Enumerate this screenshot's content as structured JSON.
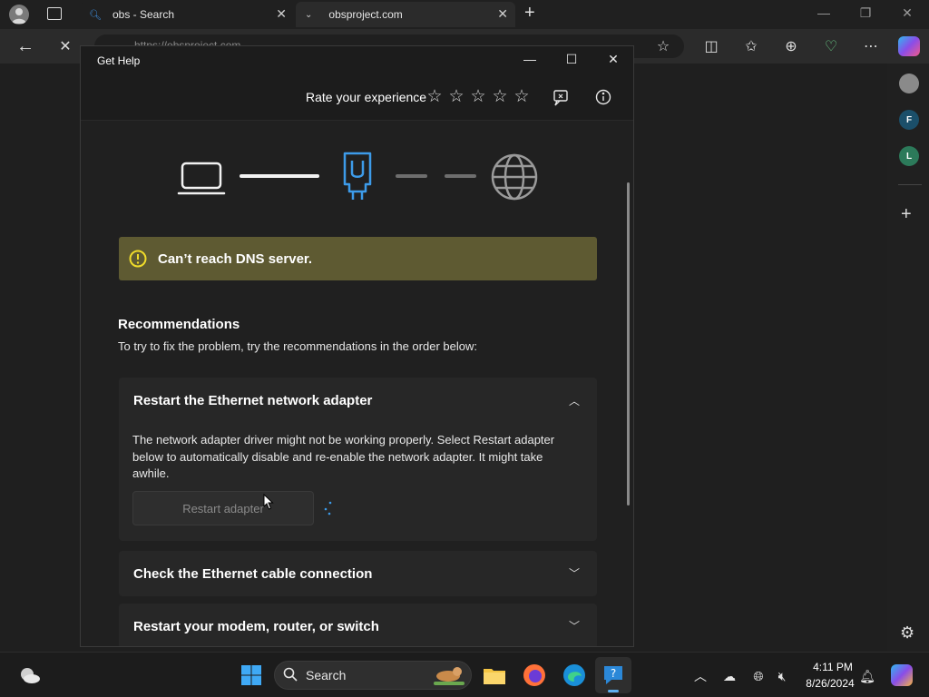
{
  "browser": {
    "tabs": [
      {
        "title": "obs - Search"
      },
      {
        "title": "obsproject.com"
      }
    ],
    "address": "https://obsproject.com",
    "sidebar_badges": [
      "F",
      "L"
    ]
  },
  "gethelp": {
    "window_title": "Get Help",
    "rate_label": "Rate your experience",
    "rating_max": 5,
    "banner": "Can’t reach DNS server.",
    "recommendations_title": "Recommendations",
    "recommendations_subtitle": "To try to fix the problem, try the recommendations in the order below:",
    "cards": [
      {
        "title": "Restart the Ethernet network adapter",
        "expanded": true,
        "description": "The network adapter driver might not be working properly. Select Restart adapter below to automatically disable and re-enable the network adapter. It might take awhile.",
        "button": "Restart adapter"
      },
      {
        "title": "Check the Ethernet cable connection",
        "expanded": false
      },
      {
        "title": "Restart your modem, router, or switch",
        "expanded": false
      }
    ]
  },
  "taskbar": {
    "search_label": "Search",
    "time": "4:11 PM",
    "date": "8/26/2024"
  },
  "colors": {
    "banner": "#5e5a32",
    "accent": "#3d9be9",
    "warning_icon": "#f0dc2a"
  }
}
